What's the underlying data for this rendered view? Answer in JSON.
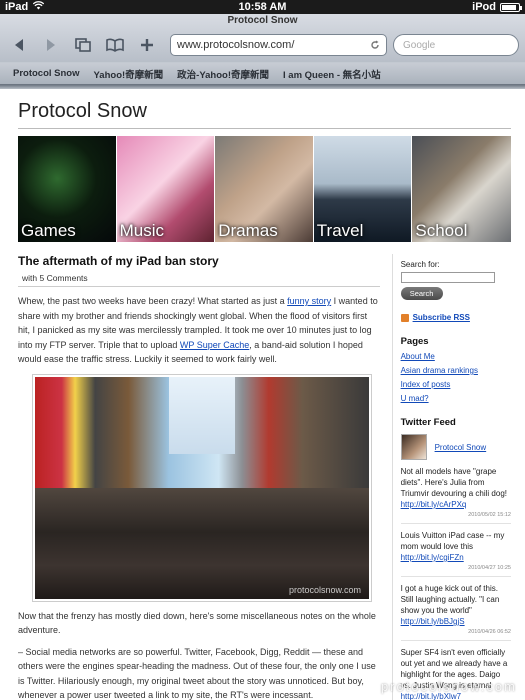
{
  "statusbar": {
    "device": "iPad",
    "time": "10:58 AM",
    "right_label": "iPod"
  },
  "browser": {
    "page_title": "Protocol Snow",
    "url": "www.protocolsnow.com/",
    "search_placeholder": "Google",
    "bookmarks": [
      "Protocol Snow",
      "Yahoo!奇摩新聞",
      "政治-Yahoo!奇摩新聞",
      "I am Queen - 無名小站"
    ]
  },
  "site": {
    "title": "Protocol Snow",
    "banner": [
      "Games",
      "Music",
      "Dramas",
      "Travel",
      "School"
    ]
  },
  "post": {
    "title": "The aftermath of my iPad ban story",
    "meta": "with 5 Comments",
    "p1_a": "Whew, the past two weeks have been crazy! What started as just a ",
    "p1_link1": "funny story",
    "p1_b": " I wanted to share with my brother and friends shockingly went global. When the flood of visitors first hit, I panicked as my site was mercilessly trampled. It took me over 10 minutes just to log into my FTP server. Triple that to upload ",
    "p1_link2": "WP Super Cache",
    "p1_c": ", a band-aid solution I hoped would ease the traffic stress. Luckily it seemed to work fairly well.",
    "photo_watermark": "protocolsnow.com",
    "p2": "Now that the frenzy has mostly died down, here's some miscellaneous notes on the whole adventure.",
    "p3": "– Social media networks are so powerful. Twitter, Facebook, Digg, Reddit — these and others were the engines spear-heading the madness. Out of these four, the only one I use is Twitter. Hilariously enough, my original tweet about the story was unnoticed. But boy, whenever a power user tweeted a link to my site, the RT's were incessant."
  },
  "sidebar": {
    "search_label": "Search for:",
    "search_button": "Search",
    "rss": "Subscribe RSS",
    "pages_heading": "Pages",
    "pages": [
      "About Me",
      "Asian drama rankings",
      "Index of posts",
      "U mad?"
    ],
    "feed_heading": "Twitter Feed",
    "feed_user": "Protocol Snow",
    "tweets": [
      {
        "text": "Not all models have \"grape diets\". Here's Julia from Triumvir devouring a chili dog!",
        "link": "http://bit.ly/cArPXq",
        "date": "2010/05/02 15:12"
      },
      {
        "text": "Louis Vuitton iPad case -- my mom would love this",
        "link": "http://bit.ly/cgiFZn",
        "date": "2010/04/27 10:25"
      },
      {
        "text": "I got a huge kick out of this. Still laughing actually. \"I can show you the world\"",
        "link": "http://bit.ly/bBJgjS",
        "date": "2010/04/26 06:52"
      },
      {
        "text": "Super SF4 isn't even officially out yet and we already have a highlight for the ages. Daigo vs. Justin Wong is eternal",
        "link": "http://bit.ly/bXlw7",
        "date": ""
      }
    ]
  },
  "watermark": "protocolsnow.com"
}
